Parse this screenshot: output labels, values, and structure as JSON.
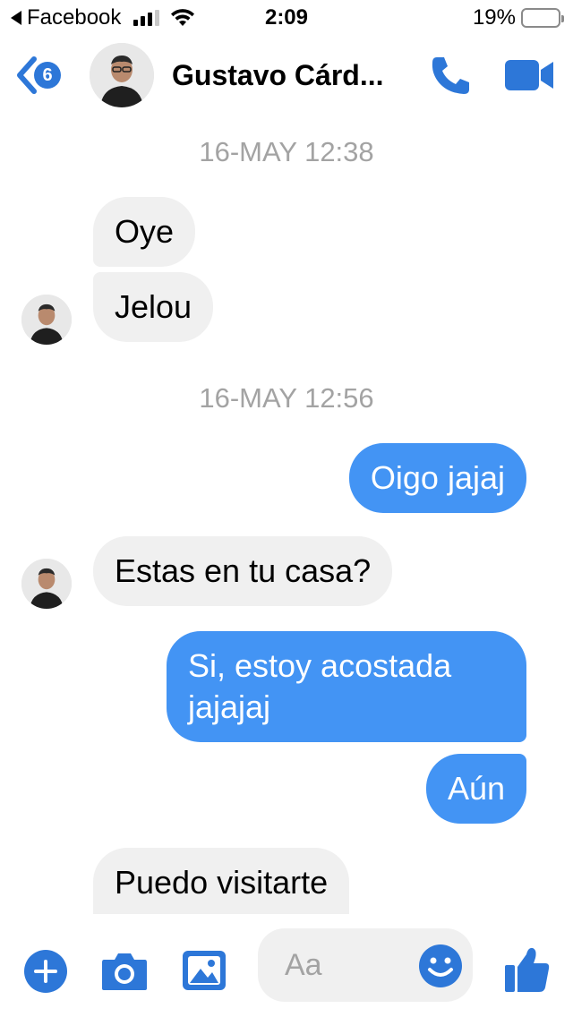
{
  "status_bar": {
    "back_app": "Facebook",
    "time": "2:09",
    "battery_percent": "19%",
    "battery_level": 0.19
  },
  "header": {
    "unread_count": "6",
    "contact_name": "Gustavo Cárd...",
    "icons": [
      "back-chevron-icon",
      "phone-icon",
      "video-camera-icon"
    ]
  },
  "conversation": {
    "timestamps": [
      "16-MAY 12:38",
      "16-MAY 12:56"
    ],
    "messages": [
      {
        "from": "contact",
        "text": "Oye"
      },
      {
        "from": "contact",
        "text": "Jelou"
      },
      {
        "from": "me",
        "text": "Oigo jajaj"
      },
      {
        "from": "contact",
        "text": "Estas en tu casa?"
      },
      {
        "from": "me",
        "text": "Si, estoy acostada",
        "text_line2": "jajajaj"
      },
      {
        "from": "me",
        "text": "Aún"
      },
      {
        "from": "contact",
        "text": "Puedo visitarte"
      }
    ]
  },
  "composer": {
    "placeholder": "Aa",
    "icons": [
      "plus-icon",
      "camera-icon",
      "image-icon",
      "emoji-icon",
      "thumbs-up-icon"
    ]
  },
  "colors": {
    "accent": "#2d77d8",
    "outgoing_bubble": "#4394f4",
    "incoming_bubble": "#f0f0f0",
    "timestamp": "#a3a3a3"
  }
}
